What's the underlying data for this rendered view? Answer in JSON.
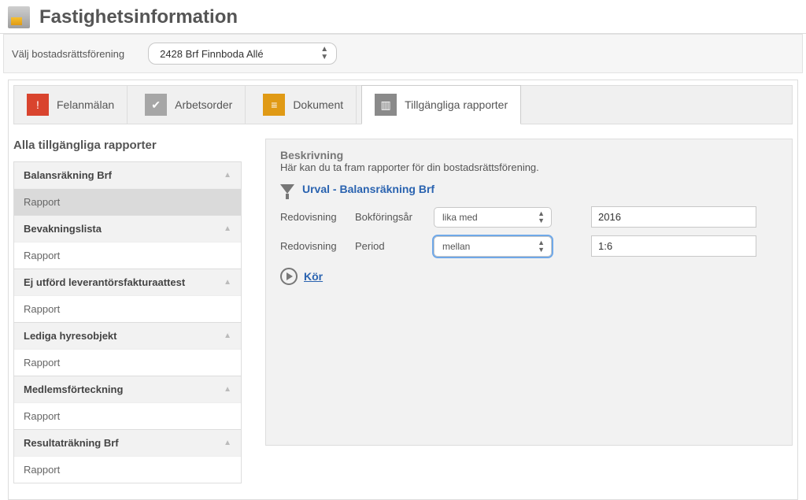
{
  "header": {
    "title": "Fastighetsinformation"
  },
  "association_selector": {
    "label": "Välj bostadsrättsförening",
    "value": "2428 Brf Finnboda Allé"
  },
  "tabs": [
    {
      "id": "felanmalan",
      "label": "Felanmälan",
      "icon": "alert-icon",
      "icon_class": "icon-red",
      "glyph": "!",
      "active": false
    },
    {
      "id": "arbetsorder",
      "label": "Arbetsorder",
      "icon": "checklist-icon",
      "icon_class": "icon-gray",
      "glyph": "✔",
      "active": false
    },
    {
      "id": "dokument",
      "label": "Dokument",
      "icon": "document-icon",
      "icon_class": "icon-orange",
      "glyph": "≡",
      "active": false
    },
    {
      "id": "rapporter",
      "label": "Tillgängliga rapporter",
      "icon": "chart-icon",
      "icon_class": "icon-darkgray",
      "glyph": "▥",
      "active": true
    }
  ],
  "reports": {
    "heading": "Alla tillgängliga rapporter",
    "groups": [
      {
        "title": "Balansräkning Brf",
        "item": "Rapport",
        "selected": true
      },
      {
        "title": "Bevakningslista",
        "item": "Rapport",
        "selected": false
      },
      {
        "title": "Ej utförd leverantörsfakturaattest",
        "item": "Rapport",
        "selected": false
      },
      {
        "title": "Lediga hyresobjekt",
        "item": "Rapport",
        "selected": false
      },
      {
        "title": "Medlemsförteckning",
        "item": "Rapport",
        "selected": false
      },
      {
        "title": "Resultaträkning Brf",
        "item": "Rapport",
        "selected": false
      }
    ]
  },
  "panel": {
    "desc_title": "Beskrivning",
    "desc_text": "Här kan du ta fram rapporter för din bostadsrättsförening.",
    "urval_title": "Urval - Balansräkning Brf",
    "filters": [
      {
        "group": "Redovisning",
        "field": "Bokföringsår",
        "operator": "lika med",
        "value": "2016",
        "focused": false
      },
      {
        "group": "Redovisning",
        "field": "Period",
        "operator": "mellan",
        "value": "1:6",
        "focused": true
      }
    ],
    "run_label": "Kör"
  }
}
